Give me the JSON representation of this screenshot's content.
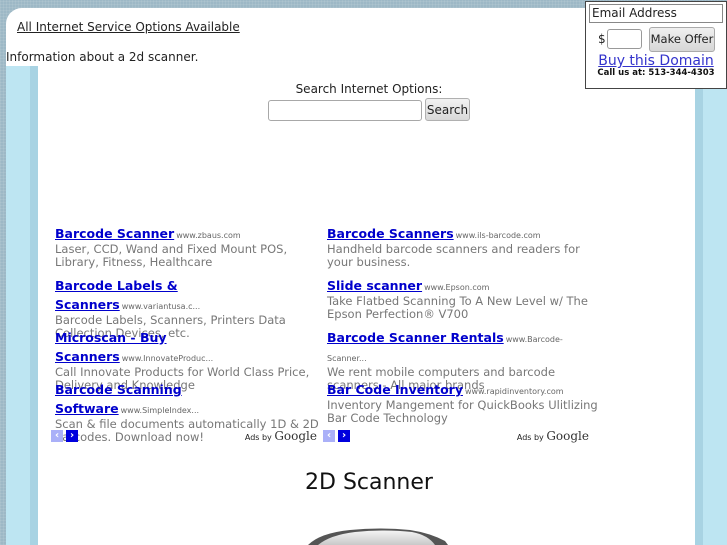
{
  "header": {
    "top_link": "All Internet Service Options Available",
    "info_text": "Information about a 2d scanner."
  },
  "search": {
    "label": "Search Internet Options:",
    "value": "",
    "button": "Search"
  },
  "ads": {
    "left": [
      {
        "title": "Barcode Scanner",
        "url": "www.zbaus.com",
        "desc": "Laser, CCD, Wand and Fixed Mount POS, Library, Fitness, Healthcare"
      },
      {
        "title": "Barcode Labels & Scanners",
        "url": "www.variantusa.c...",
        "desc": "Barcode Labels, Scanners, Printers Data Collection Devices, etc."
      },
      {
        "title": "Microscan - Buy Scanners",
        "url": "www.InnovateProduc...",
        "desc": "Call Innovate Products for World Class Price, Delivery and Knowledge"
      },
      {
        "title": "Barcode Scanning Software",
        "url": "www.SimpleIndex...",
        "desc": "Scan & file documents automatically 1D & 2D barcodes. Download now!"
      }
    ],
    "right": [
      {
        "title": "Barcode Scanners",
        "url": "www.ils-barcode.com",
        "desc": "Handheld barcode scanners and readers for your business."
      },
      {
        "title": "Slide scanner",
        "url": "www.Epson.com",
        "desc": "Take Flatbed Scanning To A New Level w/ The Epson Perfection® V700"
      },
      {
        "title": "Barcode Scanner Rentals",
        "url": "www.Barcode-Scanner...",
        "desc": "We rent mobile computers and barcode scanners - All major brands"
      },
      {
        "title": "Bar Code Inventory",
        "url": "www.rapidinventory.com",
        "desc": "Inventory Mangement for QuickBooks Ulitlizing Bar Code Technology"
      }
    ],
    "ads_by": "Ads by",
    "google": "Google",
    "prev_icon": "‹",
    "next_icon": "›"
  },
  "main": {
    "heading": "2D Scanner"
  },
  "offer": {
    "email_placeholder": "Email Address",
    "currency": "$",
    "amount": "",
    "button": "Make Offer",
    "buy_link": "Buy this Domain",
    "call": "Call us at: 513-344-4303"
  }
}
